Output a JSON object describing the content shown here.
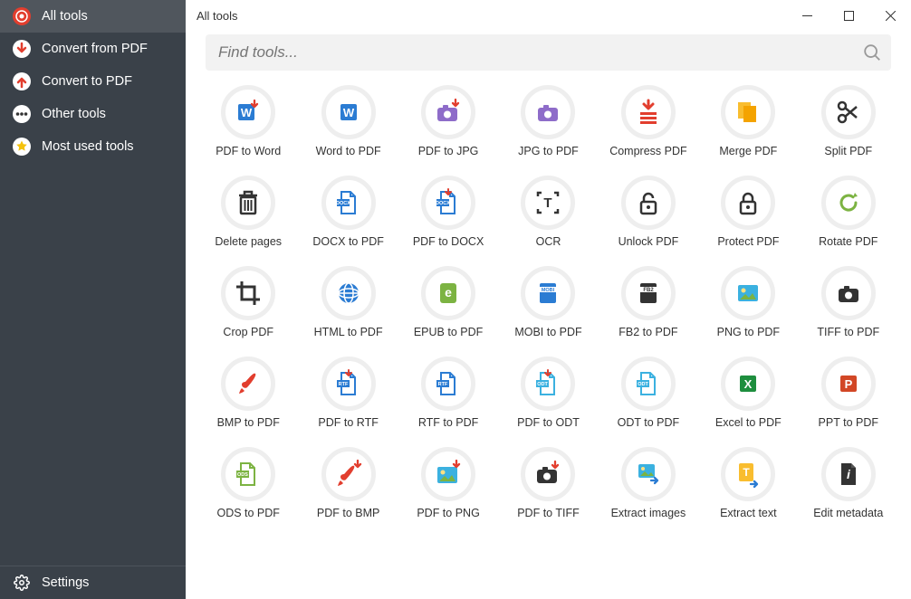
{
  "window": {
    "title": "All tools"
  },
  "search": {
    "placeholder": "Find tools..."
  },
  "sidebar": {
    "items": [
      {
        "label": "All tools",
        "icon": "target",
        "color": "#e23e2e",
        "active": true
      },
      {
        "label": "Convert from PDF",
        "icon": "arrow-down",
        "color": "#e23e2e"
      },
      {
        "label": "Convert to PDF",
        "icon": "arrow-up",
        "color": "#e23e2e"
      },
      {
        "label": "Other tools",
        "icon": "dots",
        "color": "#333"
      },
      {
        "label": "Most used tools",
        "icon": "star",
        "color": "#f4c20d"
      }
    ],
    "footer": {
      "label": "Settings",
      "icon": "gear"
    }
  },
  "tools": [
    {
      "label": "PDF to Word",
      "icon": "word-in",
      "color": "#2b7cd3"
    },
    {
      "label": "Word to PDF",
      "icon": "word",
      "color": "#2b7cd3"
    },
    {
      "label": "PDF to JPG",
      "icon": "camera-in",
      "color": "#8e6cc9"
    },
    {
      "label": "JPG to PDF",
      "icon": "camera",
      "color": "#8e6cc9"
    },
    {
      "label": "Compress PDF",
      "icon": "compress",
      "color": "#e23e2e"
    },
    {
      "label": "Merge PDF",
      "icon": "merge",
      "color": "#f9bd2f"
    },
    {
      "label": "Split PDF",
      "icon": "split",
      "color": "#333"
    },
    {
      "label": "Delete pages",
      "icon": "trash",
      "color": "#333"
    },
    {
      "label": "DOCX to PDF",
      "icon": "docx",
      "color": "#2b7cd3"
    },
    {
      "label": "PDF to DOCX",
      "icon": "docx-in",
      "color": "#2b7cd3"
    },
    {
      "label": "OCR",
      "icon": "ocr",
      "color": "#333"
    },
    {
      "label": "Unlock PDF",
      "icon": "unlock",
      "color": "#333"
    },
    {
      "label": "Protect PDF",
      "icon": "lock",
      "color": "#333"
    },
    {
      "label": "Rotate PDF",
      "icon": "rotate",
      "color": "#7cb342"
    },
    {
      "label": "Crop PDF",
      "icon": "crop",
      "color": "#333"
    },
    {
      "label": "HTML to PDF",
      "icon": "globe",
      "color": "#2b7cd3"
    },
    {
      "label": "EPUB to PDF",
      "icon": "epub",
      "color": "#7cb342"
    },
    {
      "label": "MOBI to PDF",
      "icon": "mobi",
      "color": "#2b7cd3"
    },
    {
      "label": "FB2 to PDF",
      "icon": "fb2",
      "color": "#333"
    },
    {
      "label": "PNG to PDF",
      "icon": "png",
      "color": "#3bb1e0"
    },
    {
      "label": "TIFF to PDF",
      "icon": "camera",
      "color": "#333"
    },
    {
      "label": "BMP to PDF",
      "icon": "brush",
      "color": "#e23e2e"
    },
    {
      "label": "PDF to RTF",
      "icon": "rtf-in",
      "color": "#2b7cd3"
    },
    {
      "label": "RTF to PDF",
      "icon": "rtf",
      "color": "#2b7cd3"
    },
    {
      "label": "PDF to ODT",
      "icon": "odt-in",
      "color": "#3bb1e0"
    },
    {
      "label": "ODT to PDF",
      "icon": "odt",
      "color": "#3bb1e0"
    },
    {
      "label": "Excel to PDF",
      "icon": "excel",
      "color": "#1e8e3e"
    },
    {
      "label": "PPT to PDF",
      "icon": "ppt",
      "color": "#d24726"
    },
    {
      "label": "ODS to PDF",
      "icon": "ods",
      "color": "#7cb342"
    },
    {
      "label": "PDF to BMP",
      "icon": "brush-in",
      "color": "#e23e2e"
    },
    {
      "label": "PDF to PNG",
      "icon": "png-in",
      "color": "#3bb1e0"
    },
    {
      "label": "PDF to TIFF",
      "icon": "camera-in2",
      "color": "#333"
    },
    {
      "label": "Extract images",
      "icon": "extract-img",
      "color": "#3bb1e0"
    },
    {
      "label": "Extract text",
      "icon": "extract-txt",
      "color": "#f9bd2f"
    },
    {
      "label": "Edit metadata",
      "icon": "metadata",
      "color": "#333"
    }
  ]
}
